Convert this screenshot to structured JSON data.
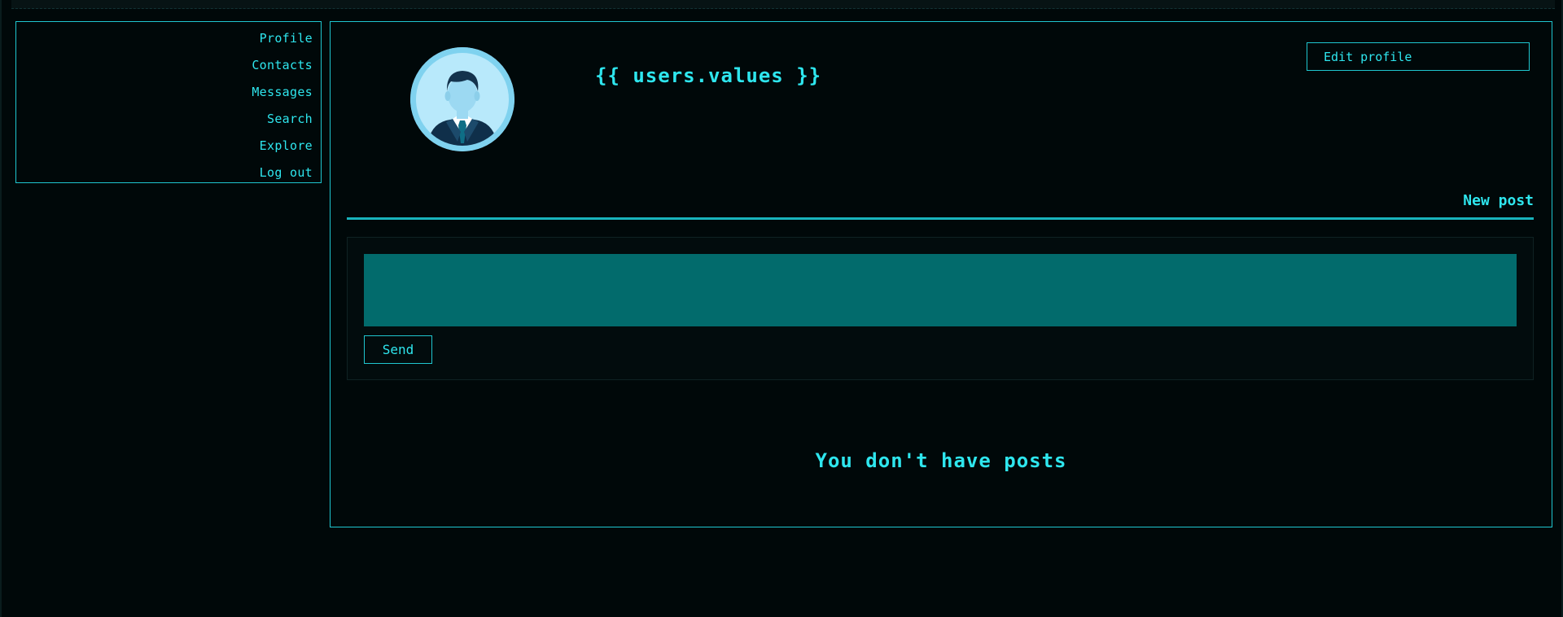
{
  "sidebar": {
    "items": [
      {
        "label": "Profile"
      },
      {
        "label": "Contacts"
      },
      {
        "label": "Messages"
      },
      {
        "label": "Search"
      },
      {
        "label": "Explore"
      },
      {
        "label": "Log out"
      }
    ]
  },
  "profile": {
    "username": "{{ users.values }}",
    "edit_label": "Edit profile",
    "avatar_icon": "user-avatar-icon"
  },
  "tabs": {
    "new_post_label": "New post"
  },
  "composer": {
    "input_value": "",
    "input_placeholder": "",
    "send_label": "Send"
  },
  "posts": {
    "empty_message": "You don't have posts"
  },
  "colors": {
    "accent": "#2ee6ee",
    "border": "#1fc6cf",
    "input_bg": "#026b6c",
    "background": "#000809"
  }
}
